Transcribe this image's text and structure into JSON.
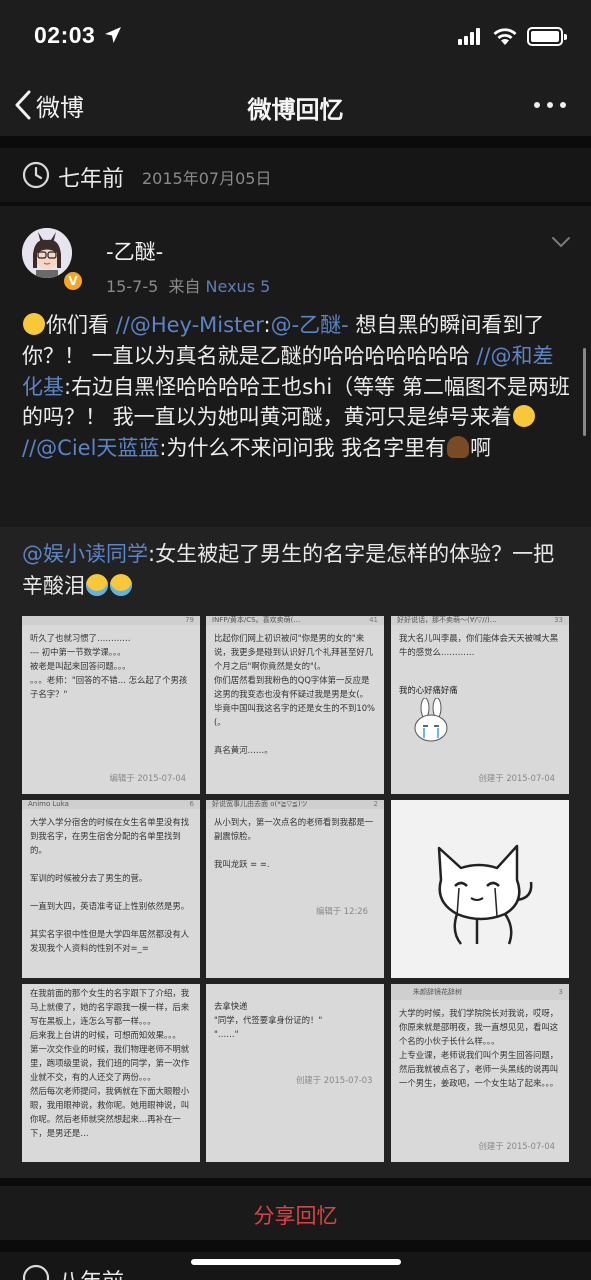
{
  "status_bar": {
    "time": "02:03"
  },
  "nav": {
    "back_label": "微博",
    "title": "微博回忆"
  },
  "memory": {
    "ago": "七年前",
    "date": "2015年07月05日"
  },
  "post": {
    "username": "-乙醚-",
    "time": "15-7-5",
    "source_prefix": "来自",
    "device": "Nexus 5",
    "text_segments": [
      {
        "t": "你们看 "
      },
      {
        "t": "//@Hey-Mister",
        "m": true
      },
      {
        "t": ":"
      },
      {
        "t": "@-乙醚-",
        "m": true
      },
      {
        "t": " 想自黑的瞬间看到了你？！ 一直以为真名就是乙醚的哈哈哈哈哈哈哈 "
      },
      {
        "t": "//@和差化基",
        "m": true
      },
      {
        "t": ":右边自黑怪哈哈哈哈王也shi（等等 第二幅图不是两班的吗？！ 我一直以为她叫黄河醚，黄河只是绰号来着"
      },
      {
        "t": " "
      },
      {
        "t": "//@Ciel天蓝蓝",
        "m": true
      },
      {
        "t": ":为什么不来问问我 我名字里有"
      },
      {
        "t": "啊"
      }
    ]
  },
  "repost": {
    "mention": "@娱小读同学",
    "text": ":女生被起了男生的名字是怎样的体验？一把辛酸泪"
  },
  "images": [
    {
      "header": "",
      "count": "79",
      "body": "听久了也就习惯了…………\n--- 初中第一节数学课。。。\n被老是叫起来回答问题。。。\n。。。老师：\"回答的不错… 怎么起了个男孩子名字？\"",
      "foot": "编辑于 2015-07-04"
    },
    {
      "header": "INFP/黄本/CS。喜欢卖萌(…",
      "count": "41",
      "body": "比起你们网上初识被问\"你是男的女的\"来说，我更多是碰到认识好几个礼拜甚至好几个月之后\"啊你竟然是女的\"(。\n你们居然看到我粉色的QQ字体第一反应是这男的我变态也没有怀疑过我是男是女(。\n毕竟中国叫我这名字的还是女生的不到10%(。\n\n真名黄河……。",
      "foot": ""
    },
    {
      "header": "好好说话，那不卖萌～(∀/▽//)…",
      "count": "33",
      "body": "我大名儿叫李晨，你们能体会天天被喊大黑牛的感觉么…………",
      "foot": "创建于 2015-07-04"
    },
    {
      "header": "Animo Luka",
      "count": "6",
      "body": "大学入学分宿舍的时候在女生名单里没有找到我名字，在男生宿舍分配的名单里找到的。\n\n军训的时候被分去了男生的营。\n\n一直到大四，英语准考证上性别依然是男。\n\n其实名字很中性但是大学四年居然都没有人发现我个人资料的性别不对=_=",
      "foot": ""
    },
    {
      "header": "好说宽事儿由去面 o(*≧▽≦)ツ",
      "count": "2",
      "body": "从小到大，第一次点名的老师看到我都是一副震惊脸。\n\n我叫龙跃 = =.",
      "foot": "编辑于 12:26"
    },
    {
      "header": "",
      "count": "",
      "body": "",
      "foot": ""
    },
    {
      "header": "",
      "count": "",
      "body": "在我前面的那个女生的名字跟下了介绍，我马上就傻了，她的名字跟我一模一样，后来写在黑板上，连怎么写都一样。。。\n后来我上台讲的时候，可想而知效果。。。\n第一次交作业的时候，我们物理老师不明就里，跑项级里说，我们班的同学，第一次作业就不交，有的人还交了两份。。。\n然后每次老师提问，我俩就在下面大眼瞪小眼，我用眼神说，救你呢。她用眼神说，叫你呢。然后老师就突然想起来…再补在一下，是男还是…",
      "foot": ""
    },
    {
      "header": "",
      "count": "",
      "body": "去拿快递\n\"同学，代签要拿身份证的！\"\n\"……\"",
      "foot": "创建于 2015-07-03"
    },
    {
      "header": "朱颜辞镜花辞树",
      "count": "3",
      "body": "大学的时候，我们学院院长对我说，哎呀，你原来就是邵明夜，我一直想见见，看叫这个名的小伙子长什么样。。。\n上专业课，老师说我们叫个男生回答问题，然后我就被点名了，老师一头黑线的说再叫一个男生，姜政吧，一个女生站了起来。。。",
      "foot": "创建于 2015-07-04"
    }
  ],
  "cell2_mood": "我的心好痛好痛",
  "share_label": "分享回忆",
  "next_memory": {
    "ago": "八年前"
  }
}
